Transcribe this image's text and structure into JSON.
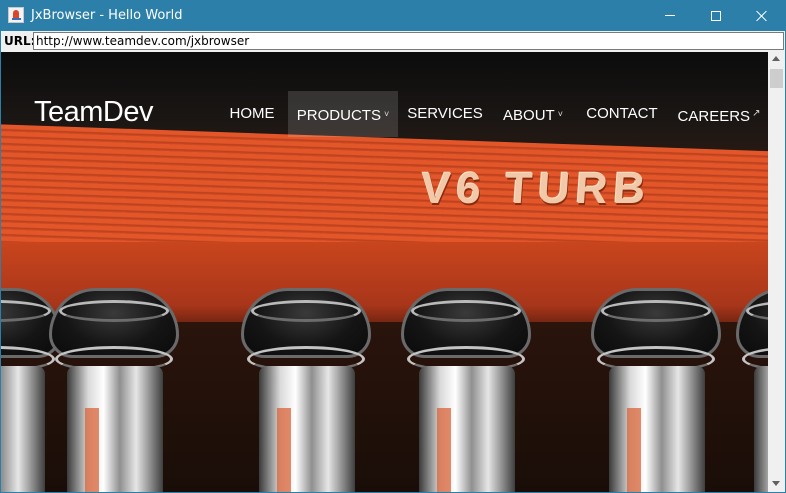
{
  "window": {
    "title": "JxBrowser - Hello World",
    "minimize_icon": "minimize-icon",
    "maximize_icon": "maximize-icon",
    "close_icon": "close-icon",
    "titlebar_color": "#2b7fa8"
  },
  "urlbar": {
    "label": "URL:",
    "value": "http://www.teamdev.com/jxbrowser"
  },
  "site": {
    "logo": "TeamDev",
    "nav": [
      {
        "label": "HOME"
      },
      {
        "label": "PRODUCTS",
        "caret": "˅"
      },
      {
        "label": "SERVICES"
      },
      {
        "label": "ABOUT",
        "caret": "˅"
      },
      {
        "label": "CONTACT"
      },
      {
        "label": "CAREERS",
        "ext": "↗"
      }
    ],
    "hero_text": "V6 TURB",
    "accent_color": "#e2562a"
  }
}
